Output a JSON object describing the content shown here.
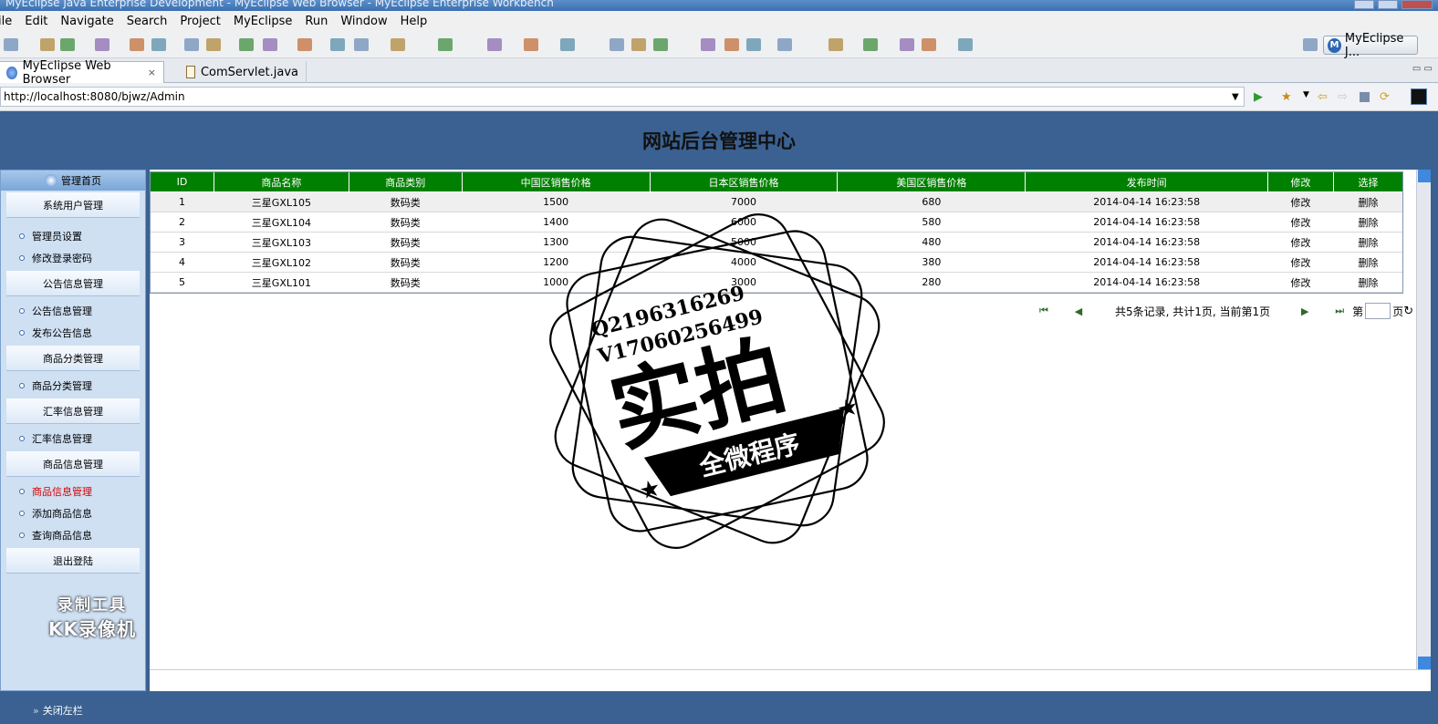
{
  "window": {
    "title": "MyEclipse Java Enterprise Development - MyEclipse Web Browser - MyEclipse Enterprise Workbench"
  },
  "menu": [
    "ile",
    "Edit",
    "Navigate",
    "Search",
    "Project",
    "MyEclipse",
    "Run",
    "Window",
    "Help"
  ],
  "toolbar": {
    "perspective_label": "MyEclipse J...",
    "perspective_logo": "M"
  },
  "tabs": [
    {
      "label": "MyEclipse Web Browser",
      "close": "×"
    },
    {
      "label": "ComServlet.java"
    }
  ],
  "browser": {
    "url": "http://localhost:8080/bjwz/Admin"
  },
  "page": {
    "title": "网站后台管理中心"
  },
  "sidebar": {
    "home_label": "管理首页",
    "groups": [
      {
        "label": "系统用户管理",
        "items": [
          "管理员设置",
          "修改登录密码"
        ]
      },
      {
        "label": "公告信息管理",
        "items": [
          "公告信息管理",
          "发布公告信息"
        ]
      },
      {
        "label": "商品分类管理",
        "items": [
          "商品分类管理"
        ]
      },
      {
        "label": "汇率信息管理",
        "items": [
          "汇率信息管理"
        ]
      },
      {
        "label": "商品信息管理",
        "items": [
          "商品信息管理",
          "添加商品信息",
          "查询商品信息"
        ]
      }
    ],
    "active_item": "商品信息管理",
    "logout_label": "退出登陆",
    "watermark": [
      "录制工具",
      "KK录像机"
    ]
  },
  "table": {
    "columns": [
      "ID",
      "商品名称",
      "商品类别",
      "中国区销售价格",
      "日本区销售价格",
      "美国区销售价格",
      "发布时间",
      "修改",
      "选择"
    ],
    "rows": [
      {
        "id": "1",
        "name": "三星GXL105",
        "category": "数码类",
        "cn_price": "1500",
        "jp_price": "7000",
        "us_price": "680",
        "time": "2014-04-14 16:23:58",
        "edit": "修改",
        "del": "删除"
      },
      {
        "id": "2",
        "name": "三星GXL104",
        "category": "数码类",
        "cn_price": "1400",
        "jp_price": "6000",
        "us_price": "580",
        "time": "2014-04-14 16:23:58",
        "edit": "修改",
        "del": "删除"
      },
      {
        "id": "3",
        "name": "三星GXL103",
        "category": "数码类",
        "cn_price": "1300",
        "jp_price": "5000",
        "us_price": "480",
        "time": "2014-04-14 16:23:58",
        "edit": "修改",
        "del": "删除"
      },
      {
        "id": "4",
        "name": "三星GXL102",
        "category": "数码类",
        "cn_price": "1200",
        "jp_price": "4000",
        "us_price": "380",
        "time": "2014-04-14 16:23:58",
        "edit": "修改",
        "del": "删除"
      },
      {
        "id": "5",
        "name": "三星GXL101",
        "category": "数码类",
        "cn_price": "1000",
        "jp_price": "3000",
        "us_price": "280",
        "time": "2014-04-14 16:23:58",
        "edit": "修改",
        "del": "删除"
      }
    ]
  },
  "pager": {
    "first": "⏮",
    "prev": "◀",
    "info": "共5条记录, 共计1页, 当前第1页",
    "next": "▶",
    "last": "⏭",
    "page_prefix": "第",
    "page_suffix": "页",
    "go_icon": "↻"
  },
  "footer": {
    "close_left_label": "关闭左栏"
  },
  "stamp": {
    "line1": "Q2196316269",
    "line2": "V17060256499",
    "big": "实拍",
    "ribbon": "全微程序"
  },
  "colors": {
    "header_green": "#008000",
    "page_blue": "#3a6191",
    "active_red": "#d40000"
  }
}
